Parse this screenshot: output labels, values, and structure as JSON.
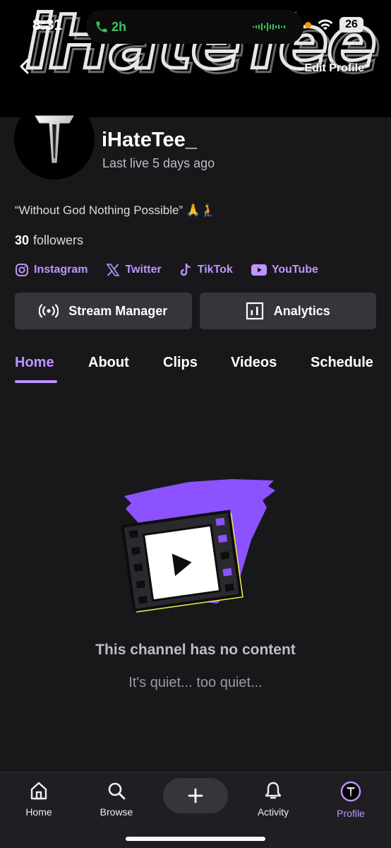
{
  "status_bar": {
    "time": "8:31",
    "call_duration": "2h",
    "battery": "26"
  },
  "banner": {
    "text": "iHateTee"
  },
  "header": {
    "edit_profile_label": "Edit Profile"
  },
  "profile": {
    "avatar_letter": "T",
    "username": "iHateTee_",
    "last_live": "Last live 5 days ago",
    "bio": "“Without God Nothing Possible”",
    "bio_emoji": "🙏🧎",
    "followers_count": "30",
    "followers_label": "followers"
  },
  "socials": [
    {
      "label": "Instagram",
      "icon": "instagram-icon"
    },
    {
      "label": "Twitter",
      "icon": "x-icon"
    },
    {
      "label": "TikTok",
      "icon": "tiktok-icon"
    },
    {
      "label": "YouTube",
      "icon": "youtube-icon"
    }
  ],
  "actions": {
    "stream_manager_label": "Stream Manager",
    "analytics_label": "Analytics"
  },
  "tabs": [
    {
      "label": "Home",
      "active": true
    },
    {
      "label": "About",
      "active": false
    },
    {
      "label": "Clips",
      "active": false
    },
    {
      "label": "Videos",
      "active": false
    },
    {
      "label": "Schedule",
      "active": false
    }
  ],
  "empty_state": {
    "title": "This channel has no content",
    "subtitle": "It's quiet... too quiet..."
  },
  "bottom_nav": [
    {
      "label": "Home",
      "icon": "home-icon"
    },
    {
      "label": "Browse",
      "icon": "search-icon"
    },
    {
      "label": "Activity",
      "icon": "bell-icon"
    },
    {
      "label": "Profile",
      "icon": "profile-avatar-icon"
    }
  ],
  "colors": {
    "accent": "#bf94ff",
    "background": "#18181b",
    "button": "#35353b",
    "art_purple": "#8c52ff",
    "art_yellow": "#f4f34a"
  }
}
